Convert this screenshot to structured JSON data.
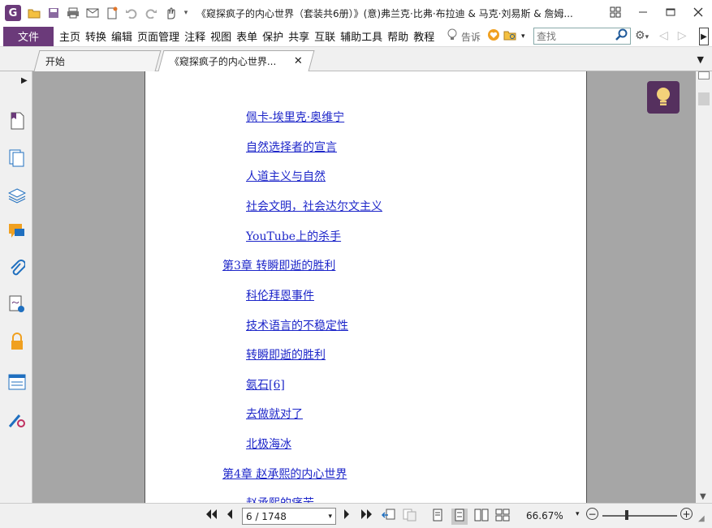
{
  "window": {
    "title": "《窥探疯子的内心世界（套装共6册）》(意)弗兰克·比弗·布拉迪 & 马克·刘易斯 & 詹姆...",
    "app_logo": "G",
    "minimize_icon": "restore-group-icon"
  },
  "menu": {
    "file_label": "文件",
    "items": [
      "主页",
      "转换",
      "编辑",
      "页面管理",
      "注释",
      "视图",
      "表单",
      "保护",
      "共享",
      "互联",
      "辅助工具",
      "帮助",
      "教程"
    ],
    "tell_me": "告诉",
    "search_placeholder": "查找"
  },
  "tabs": {
    "home": "开始",
    "doc": "《窥探疯子的内心世界..."
  },
  "toc": {
    "entries": [
      {
        "text": "佩卡-埃里克·奥维宁",
        "level": "sub"
      },
      {
        "text": "自然选择者的宣言",
        "level": "sub"
      },
      {
        "text": "人道主义与自然",
        "level": "sub"
      },
      {
        "text": "社会文明，社会达尔文主义",
        "level": "sub"
      },
      {
        "text": "YouTube上的杀手",
        "level": "sub"
      },
      {
        "text": "第3章 转瞬即逝的胜利",
        "level": "chap"
      },
      {
        "text": "科伦拜恩事件",
        "level": "sub"
      },
      {
        "text": "技术语言的不稳定性",
        "level": "sub"
      },
      {
        "text": "转瞬即逝的胜利",
        "level": "sub"
      },
      {
        "text": "氨石[6]",
        "level": "sub"
      },
      {
        "text": "去做就对了",
        "level": "sub"
      },
      {
        "text": "北极海冰",
        "level": "sub"
      },
      {
        "text": "第4章 赵承熙的内心世界",
        "level": "chap"
      },
      {
        "text": "赵承熙的痛苦",
        "level": "sub"
      }
    ]
  },
  "status": {
    "page_indicator": "6 / 1748",
    "zoom": "66.67%"
  },
  "colors": {
    "brand": "#6b3a7a",
    "link": "#1d26c9",
    "bulb_bg": "#55305e"
  }
}
